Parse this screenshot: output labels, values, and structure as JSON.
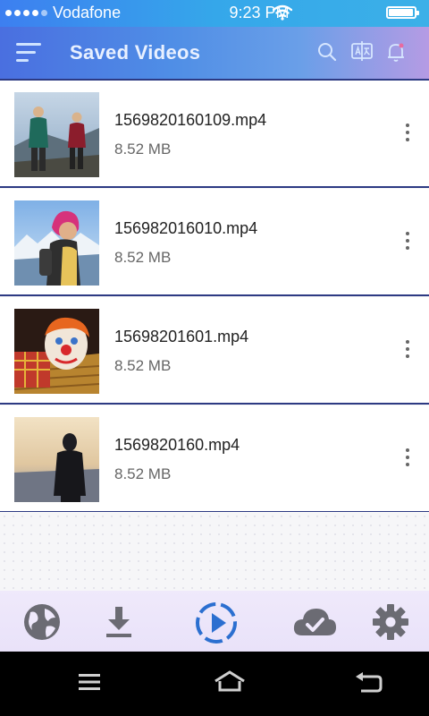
{
  "status": {
    "carrier": "Vodafone",
    "time": "9:23 PM",
    "signal_bars": 4,
    "battery_level": 0.95
  },
  "appbar": {
    "title": "Saved Videos",
    "icons": [
      "menu-icon",
      "search-icon",
      "translate-icon",
      "bell-icon"
    ]
  },
  "videos": [
    {
      "name": "1569820160109.mp4",
      "size": "8.52 MB",
      "thumb": "hikers-couple"
    },
    {
      "name": "156982016010.mp4",
      "size": "8.52 MB",
      "thumb": "girl-mountains"
    },
    {
      "name": "15698201601.mp4",
      "size": "8.52 MB",
      "thumb": "clown"
    },
    {
      "name": "1569820160.mp4",
      "size": "8.52 MB",
      "thumb": "woman-sunset"
    }
  ],
  "bottom_nav": {
    "items": [
      "browser-globe-icon",
      "download-icon",
      "play-icon",
      "cloud-check-icon",
      "settings-gear-icon"
    ],
    "active": "play-icon",
    "colors": {
      "inactive": "#6b6b73",
      "active": "#2b6fd0"
    }
  },
  "system_nav": [
    "menu-lines-icon",
    "home-icon",
    "back-icon"
  ]
}
